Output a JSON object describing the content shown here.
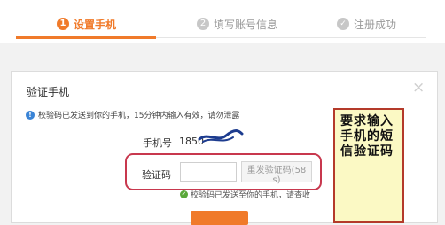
{
  "steps": [
    {
      "num": "1",
      "label": "设置手机",
      "active": true
    },
    {
      "num": "2",
      "label": "填写账号信息",
      "active": false
    },
    {
      "num": "✓",
      "label": "注册成功",
      "active": false
    }
  ],
  "dialog": {
    "title": "验证手机",
    "close": "×",
    "info_icon": "!",
    "info_text": "校验码已发送到你的手机，15分钟内输入有效，请勿泄露",
    "phone_label": "手机号",
    "phone_value": "1850",
    "code_label": "验证码",
    "code_value": "",
    "resend_label": "重发验证码(58 s)",
    "sent_icon": "✓",
    "sent_text": "校验码已发送至你的手机，请查收"
  },
  "annotation": {
    "text": "要求输入手机的短信验证码"
  },
  "colors": {
    "accent": "#f07a2a",
    "highlight": "#c8384e",
    "note_bg": "#fbf9c4",
    "info_blue": "#3a84d6",
    "ok_green": "#5aa83a"
  },
  "icons": {
    "close": "close-icon",
    "info": "info-icon",
    "sent": "check-circle-icon",
    "done_step": "check-circle-icon"
  }
}
